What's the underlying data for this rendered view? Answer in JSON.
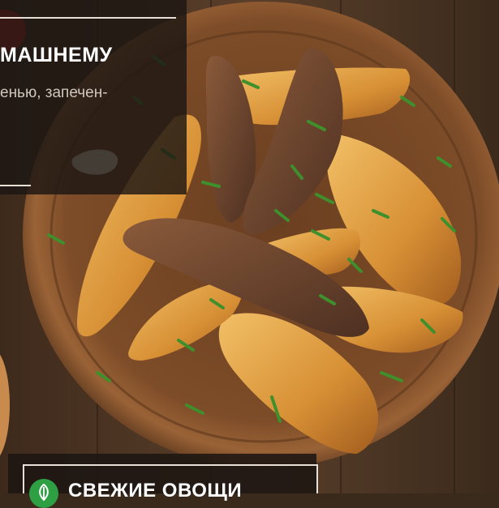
{
  "recipe_card": {
    "title": "МАШНЕМУ",
    "subtitle": "енью, запечен-"
  },
  "category_badge": {
    "icon": "leaf-icon",
    "label": "СВЕЖИЕ ОВОЩИ",
    "icon_color": "#2ea043"
  },
  "colors": {
    "plate": "#7a4b27",
    "plate_rim": "#8e5a30",
    "potato": "#d9953a",
    "herb": "#3f8f2c",
    "wood": "#4a3424"
  }
}
